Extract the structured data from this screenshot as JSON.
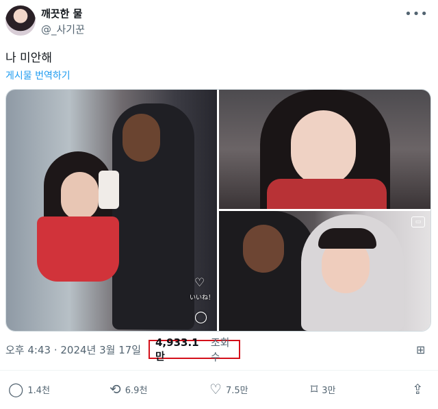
{
  "author": {
    "display_name": "깨끗한 물",
    "handle": "@_사기꾼"
  },
  "post": {
    "text": "나 미안해",
    "translate_label": "게시물 번역하기"
  },
  "media": {
    "overlay_iine": "いいね！"
  },
  "meta": {
    "time_date": "오후 4:43 · 2024년 3월 17일",
    "views_count": "4,933.1만",
    "views_label": "조회수"
  },
  "actions": {
    "replies": "1.4천",
    "reposts": "6.9천",
    "likes": "7.5만",
    "bookmarks": "3만"
  },
  "icons": {
    "more": "more-icon",
    "analytics": "analytics-icon",
    "reply": "reply-icon",
    "repost": "repost-icon",
    "like": "heart-icon",
    "bookmark": "bookmark-icon",
    "share": "share-icon"
  },
  "colors": {
    "link": "#1d9bf0",
    "highlight_box": "#d4101a",
    "muted": "#536471"
  }
}
